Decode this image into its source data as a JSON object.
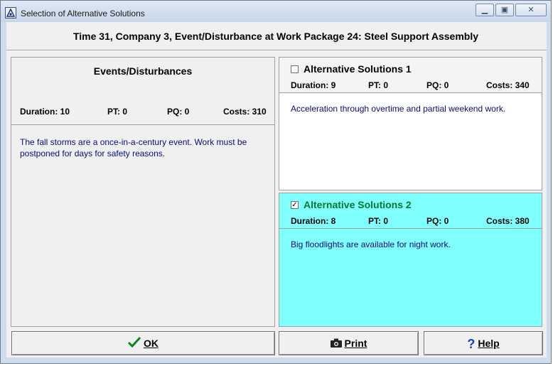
{
  "window": {
    "title": "Selection of Alternative Solutions",
    "controls": {
      "minimize": "▁",
      "restore": "▣",
      "close": "✕"
    }
  },
  "heading": "Time 31, Company 3, Event/Disturbance at Work Package 24: Steel Support Assembly",
  "event": {
    "title": "Events/Disturbances",
    "duration": "Duration: 10",
    "pt": "PT: 0",
    "pq": "PQ: 0",
    "costs": "Costs: 310",
    "description": "The fall storms are a once-in-a-century event. Work must be postponed for days for safety reasons."
  },
  "alternatives": [
    {
      "title": "Alternative Solutions 1",
      "checked": false,
      "check_glyph": "",
      "duration": "Duration: 9",
      "pt": "PT: 0",
      "pq": "PQ: 0",
      "costs": "Costs: 340",
      "description": "Acceleration through overtime and partial weekend work."
    },
    {
      "title": "Alternative Solutions 2",
      "checked": true,
      "check_glyph": "✓",
      "duration": "Duration: 8",
      "pt": "PT: 0",
      "pq": "PQ: 0",
      "costs": "Costs: 380",
      "description": "Big floodlights are available for night work."
    }
  ],
  "buttons": {
    "ok": "OK",
    "print": "Print",
    "help": "Help"
  },
  "colors": {
    "selected_bg": "#80ffff",
    "selected_title": "#007a28",
    "description_text": "#0b0b7a"
  },
  "icons": {
    "ok": "check-icon",
    "print": "camera-icon",
    "help": "question-icon"
  }
}
